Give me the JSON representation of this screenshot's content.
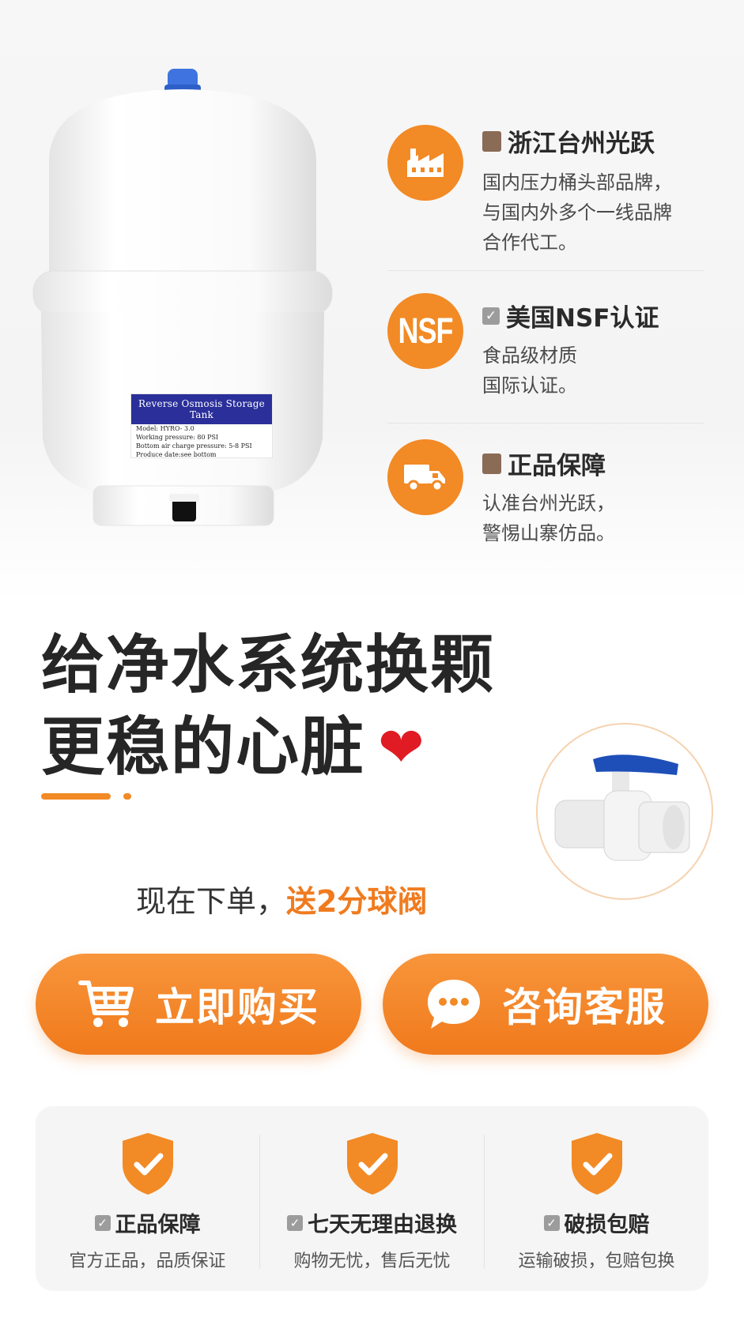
{
  "product": {
    "label_heading": "Reverse Osmosis Storage Tank",
    "label_model": "Model: HYRO- 3.0",
    "label_working_pressure": "Working pressure: 80 PSI",
    "label_air_pressure": "Bottom air charge pressure: 5-8 PSI",
    "label_produce_date": "Produce date:see bottom"
  },
  "features": [
    {
      "icon": "factory-icon",
      "title_icon": "box-icon",
      "title": "浙江台州光跃",
      "desc": [
        "国内压力桶头部品牌，",
        "与国内外多个一线品牌",
        "合作代工。"
      ]
    },
    {
      "icon": "nsf-badge",
      "badge_text": "NSF",
      "title_icon": "checkbox-icon",
      "title": "美国NSF认证",
      "desc": [
        "食品级材质",
        "国际认证。"
      ]
    },
    {
      "icon": "truck-icon",
      "title_icon": "box-icon",
      "title": "正品保障",
      "desc": [
        "认准台州光跃，",
        "警惕山寨仿品。"
      ]
    }
  ],
  "headline": {
    "line1": "给净水系统换颗",
    "line2": "更稳的心脏",
    "emoji": "❤"
  },
  "promo": {
    "prefix": "现在下单，",
    "highlight": "送2分球阀"
  },
  "buttons": {
    "buy": {
      "label": "立即购买",
      "icon": "cart-icon"
    },
    "service": {
      "label": "咨询客服",
      "icon": "chat-bubble-icon"
    }
  },
  "guarantees": [
    {
      "title": "正品保障",
      "desc": "官方正品，品质保证"
    },
    {
      "title": "七天无理由退换",
      "desc": "购物无忧，售后无忧"
    },
    {
      "title": "破损包赔",
      "desc": "运输破损，包赔包换"
    }
  ],
  "colors": {
    "accent": "#f28a25",
    "button": "#f07a1c",
    "heart": "#e01b24",
    "label_blue": "#2a2f9a",
    "valve_blue": "#1e4fb8"
  }
}
